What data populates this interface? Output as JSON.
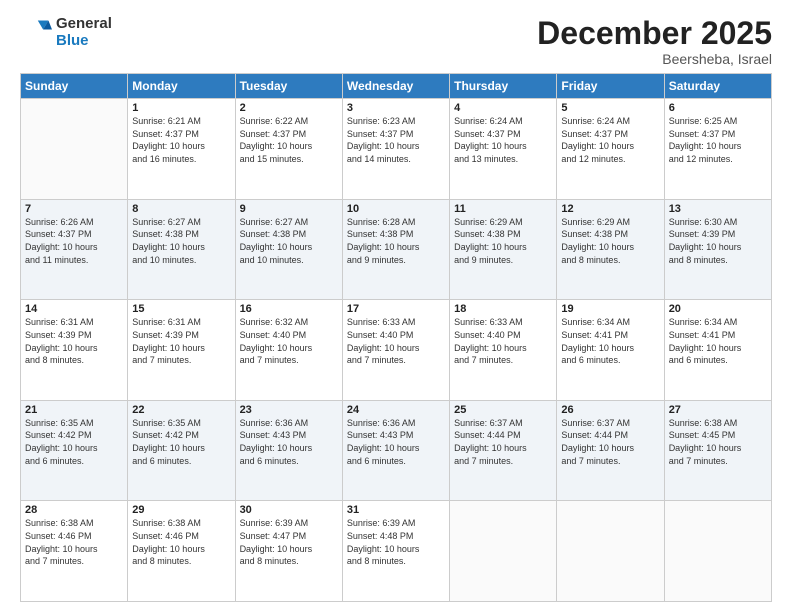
{
  "logo": {
    "general": "General",
    "blue": "Blue"
  },
  "header": {
    "month": "December 2025",
    "location": "Beersheba, Israel"
  },
  "weekdays": [
    "Sunday",
    "Monday",
    "Tuesday",
    "Wednesday",
    "Thursday",
    "Friday",
    "Saturday"
  ],
  "weeks": [
    [
      {
        "day": "",
        "info": ""
      },
      {
        "day": "1",
        "info": "Sunrise: 6:21 AM\nSunset: 4:37 PM\nDaylight: 10 hours\nand 16 minutes."
      },
      {
        "day": "2",
        "info": "Sunrise: 6:22 AM\nSunset: 4:37 PM\nDaylight: 10 hours\nand 15 minutes."
      },
      {
        "day": "3",
        "info": "Sunrise: 6:23 AM\nSunset: 4:37 PM\nDaylight: 10 hours\nand 14 minutes."
      },
      {
        "day": "4",
        "info": "Sunrise: 6:24 AM\nSunset: 4:37 PM\nDaylight: 10 hours\nand 13 minutes."
      },
      {
        "day": "5",
        "info": "Sunrise: 6:24 AM\nSunset: 4:37 PM\nDaylight: 10 hours\nand 12 minutes."
      },
      {
        "day": "6",
        "info": "Sunrise: 6:25 AM\nSunset: 4:37 PM\nDaylight: 10 hours\nand 12 minutes."
      }
    ],
    [
      {
        "day": "7",
        "info": "Sunrise: 6:26 AM\nSunset: 4:37 PM\nDaylight: 10 hours\nand 11 minutes."
      },
      {
        "day": "8",
        "info": "Sunrise: 6:27 AM\nSunset: 4:38 PM\nDaylight: 10 hours\nand 10 minutes."
      },
      {
        "day": "9",
        "info": "Sunrise: 6:27 AM\nSunset: 4:38 PM\nDaylight: 10 hours\nand 10 minutes."
      },
      {
        "day": "10",
        "info": "Sunrise: 6:28 AM\nSunset: 4:38 PM\nDaylight: 10 hours\nand 9 minutes."
      },
      {
        "day": "11",
        "info": "Sunrise: 6:29 AM\nSunset: 4:38 PM\nDaylight: 10 hours\nand 9 minutes."
      },
      {
        "day": "12",
        "info": "Sunrise: 6:29 AM\nSunset: 4:38 PM\nDaylight: 10 hours\nand 8 minutes."
      },
      {
        "day": "13",
        "info": "Sunrise: 6:30 AM\nSunset: 4:39 PM\nDaylight: 10 hours\nand 8 minutes."
      }
    ],
    [
      {
        "day": "14",
        "info": "Sunrise: 6:31 AM\nSunset: 4:39 PM\nDaylight: 10 hours\nand 8 minutes."
      },
      {
        "day": "15",
        "info": "Sunrise: 6:31 AM\nSunset: 4:39 PM\nDaylight: 10 hours\nand 7 minutes."
      },
      {
        "day": "16",
        "info": "Sunrise: 6:32 AM\nSunset: 4:40 PM\nDaylight: 10 hours\nand 7 minutes."
      },
      {
        "day": "17",
        "info": "Sunrise: 6:33 AM\nSunset: 4:40 PM\nDaylight: 10 hours\nand 7 minutes."
      },
      {
        "day": "18",
        "info": "Sunrise: 6:33 AM\nSunset: 4:40 PM\nDaylight: 10 hours\nand 7 minutes."
      },
      {
        "day": "19",
        "info": "Sunrise: 6:34 AM\nSunset: 4:41 PM\nDaylight: 10 hours\nand 6 minutes."
      },
      {
        "day": "20",
        "info": "Sunrise: 6:34 AM\nSunset: 4:41 PM\nDaylight: 10 hours\nand 6 minutes."
      }
    ],
    [
      {
        "day": "21",
        "info": "Sunrise: 6:35 AM\nSunset: 4:42 PM\nDaylight: 10 hours\nand 6 minutes."
      },
      {
        "day": "22",
        "info": "Sunrise: 6:35 AM\nSunset: 4:42 PM\nDaylight: 10 hours\nand 6 minutes."
      },
      {
        "day": "23",
        "info": "Sunrise: 6:36 AM\nSunset: 4:43 PM\nDaylight: 10 hours\nand 6 minutes."
      },
      {
        "day": "24",
        "info": "Sunrise: 6:36 AM\nSunset: 4:43 PM\nDaylight: 10 hours\nand 6 minutes."
      },
      {
        "day": "25",
        "info": "Sunrise: 6:37 AM\nSunset: 4:44 PM\nDaylight: 10 hours\nand 7 minutes."
      },
      {
        "day": "26",
        "info": "Sunrise: 6:37 AM\nSunset: 4:44 PM\nDaylight: 10 hours\nand 7 minutes."
      },
      {
        "day": "27",
        "info": "Sunrise: 6:38 AM\nSunset: 4:45 PM\nDaylight: 10 hours\nand 7 minutes."
      }
    ],
    [
      {
        "day": "28",
        "info": "Sunrise: 6:38 AM\nSunset: 4:46 PM\nDaylight: 10 hours\nand 7 minutes."
      },
      {
        "day": "29",
        "info": "Sunrise: 6:38 AM\nSunset: 4:46 PM\nDaylight: 10 hours\nand 8 minutes."
      },
      {
        "day": "30",
        "info": "Sunrise: 6:39 AM\nSunset: 4:47 PM\nDaylight: 10 hours\nand 8 minutes."
      },
      {
        "day": "31",
        "info": "Sunrise: 6:39 AM\nSunset: 4:48 PM\nDaylight: 10 hours\nand 8 minutes."
      },
      {
        "day": "",
        "info": ""
      },
      {
        "day": "",
        "info": ""
      },
      {
        "day": "",
        "info": ""
      }
    ]
  ]
}
